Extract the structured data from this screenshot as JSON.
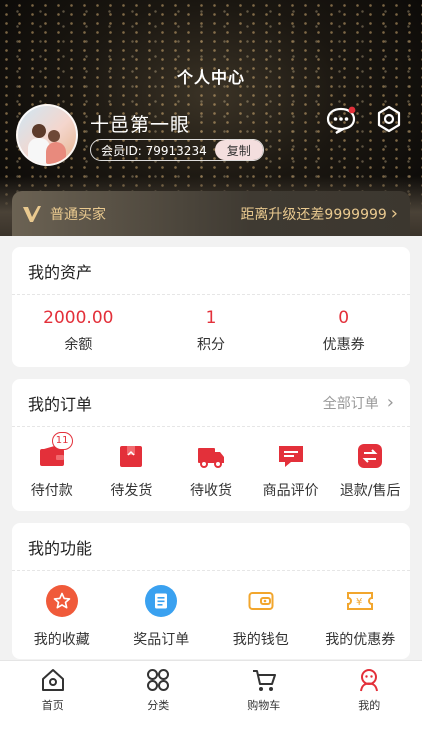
{
  "header": {
    "title": "个人中心",
    "username": "十邑第一眼",
    "member_id_label": "会员ID: 79913234",
    "copy_label": "复制"
  },
  "vip": {
    "level_label": "普通买家",
    "upgrade_text": "距离升级还差9999999",
    "chevron": "›"
  },
  "assets": {
    "title": "我的资产",
    "items": [
      {
        "value": "2000.00",
        "label": "余额"
      },
      {
        "value": "1",
        "label": "积分"
      },
      {
        "value": "0",
        "label": "优惠券"
      }
    ]
  },
  "orders": {
    "title": "我的订单",
    "all_label": "全部订单",
    "chevron": "›",
    "items": [
      {
        "label": "待付款",
        "icon": "wallet-icon",
        "badge": "11"
      },
      {
        "label": "待发货",
        "icon": "box-icon"
      },
      {
        "label": "待收货",
        "icon": "truck-icon"
      },
      {
        "label": "商品评价",
        "icon": "comment-icon"
      },
      {
        "label": "退款/售后",
        "icon": "refund-icon"
      }
    ]
  },
  "functions": {
    "title": "我的功能",
    "items": [
      {
        "label": "我的收藏",
        "icon": "star-icon",
        "color": "#f05a3a"
      },
      {
        "label": "奖品订单",
        "icon": "document-icon",
        "color": "#3aa1f0"
      },
      {
        "label": "我的钱包",
        "icon": "wallet-icon",
        "color": "#f2a62d"
      },
      {
        "label": "我的优惠券",
        "icon": "coupon-icon",
        "color": "#f2a62d"
      }
    ]
  },
  "tabbar": {
    "items": [
      {
        "label": "首页",
        "icon": "home-icon"
      },
      {
        "label": "分类",
        "icon": "grid-icon"
      },
      {
        "label": "购物车",
        "icon": "cart-icon"
      },
      {
        "label": "我的",
        "icon": "profile-icon",
        "active": true
      }
    ]
  },
  "colors": {
    "accent": "#e3303a",
    "gold": "#e9c98f"
  }
}
